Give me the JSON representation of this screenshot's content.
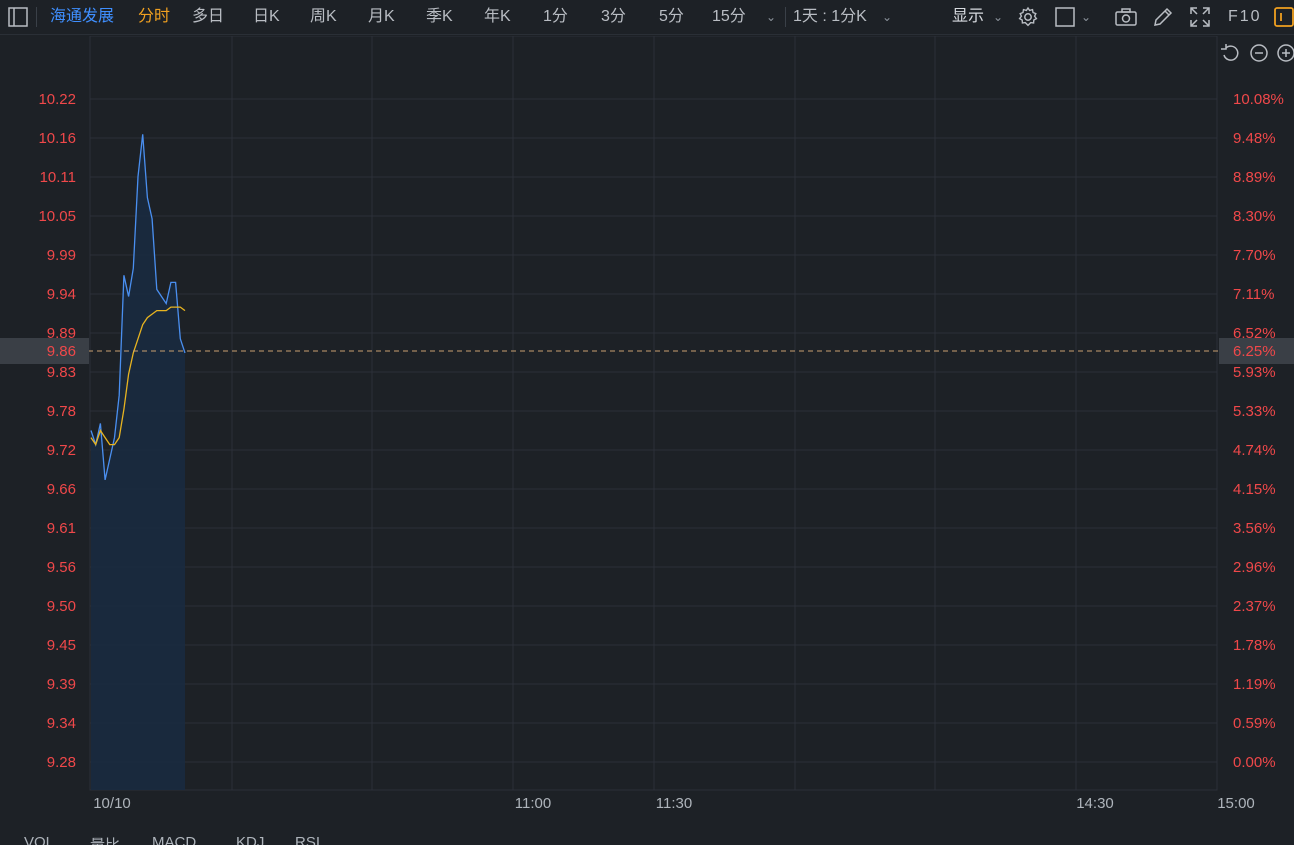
{
  "toolbar": {
    "stock_name": "海通发展",
    "tabs": [
      "分时",
      "多日",
      "日K",
      "周K",
      "月K",
      "季K",
      "年K",
      "1分",
      "3分",
      "5分",
      "15分"
    ],
    "active_tab": "分时",
    "period_selector": "1天 : 1分K",
    "display_label": "显示",
    "f10_label": "F10",
    "icons": [
      "sidebar-toggle-icon",
      "chevron-down-icon",
      "gear-icon",
      "square-select-icon",
      "camera-icon",
      "pencil-icon",
      "fullscreen-icon",
      "layout-icon"
    ]
  },
  "chart_controls": {
    "icons": [
      "undo-icon",
      "zoom-out-icon",
      "zoom-in-icon"
    ]
  },
  "chart_data": {
    "type": "line",
    "price_axis_ticks": [
      "10.22",
      "10.16",
      "10.11",
      "10.05",
      "9.99",
      "9.94",
      "9.89",
      "9.83",
      "9.78",
      "9.72",
      "9.66",
      "9.61",
      "9.56",
      "9.50",
      "9.45",
      "9.39",
      "9.34",
      "9.28"
    ],
    "percent_axis_ticks": [
      "10.08%",
      "9.48%",
      "8.89%",
      "8.30%",
      "7.70%",
      "7.11%",
      "6.52%",
      "5.93%",
      "5.33%",
      "4.74%",
      "4.15%",
      "3.56%",
      "2.96%",
      "2.37%",
      "1.78%",
      "1.19%",
      "0.59%",
      "0.00%"
    ],
    "time_axis_ticks": [
      "10/10",
      "11:00",
      "11:30",
      "14:30",
      "15:00"
    ],
    "current_price": "9.86",
    "current_change": "6.25%",
    "y_range": [
      9.28,
      10.22
    ],
    "series": [
      {
        "color": "#4a8ff0",
        "points": [
          [
            0,
            9.75
          ],
          [
            1,
            9.73
          ],
          [
            2,
            9.76
          ],
          [
            3,
            9.68
          ],
          [
            4,
            9.71
          ],
          [
            5,
            9.74
          ],
          [
            6,
            9.8
          ],
          [
            7,
            9.97
          ],
          [
            8,
            9.94
          ],
          [
            9,
            9.98
          ],
          [
            10,
            10.11
          ],
          [
            11,
            10.17
          ],
          [
            12,
            10.08
          ],
          [
            13,
            10.05
          ],
          [
            14,
            9.95
          ],
          [
            15,
            9.94
          ],
          [
            16,
            9.93
          ],
          [
            17,
            9.96
          ],
          [
            18,
            9.96
          ],
          [
            19,
            9.88
          ],
          [
            20,
            9.86
          ]
        ]
      },
      {
        "color": "#e8b420",
        "points": [
          [
            0,
            9.74
          ],
          [
            1,
            9.73
          ],
          [
            2,
            9.75
          ],
          [
            3,
            9.74
          ],
          [
            4,
            9.73
          ],
          [
            5,
            9.73
          ],
          [
            6,
            9.74
          ],
          [
            7,
            9.78
          ],
          [
            8,
            9.83
          ],
          [
            9,
            9.86
          ],
          [
            10,
            9.88
          ],
          [
            11,
            9.9
          ],
          [
            12,
            9.91
          ],
          [
            13,
            9.915
          ],
          [
            14,
            9.92
          ],
          [
            15,
            9.92
          ],
          [
            16,
            9.92
          ],
          [
            17,
            9.925
          ],
          [
            18,
            9.925
          ],
          [
            19,
            9.925
          ],
          [
            20,
            9.92
          ]
        ]
      }
    ]
  },
  "bottom_tabs": [
    "VOL",
    "量比",
    "MACD",
    "KDJ",
    "RSI"
  ]
}
